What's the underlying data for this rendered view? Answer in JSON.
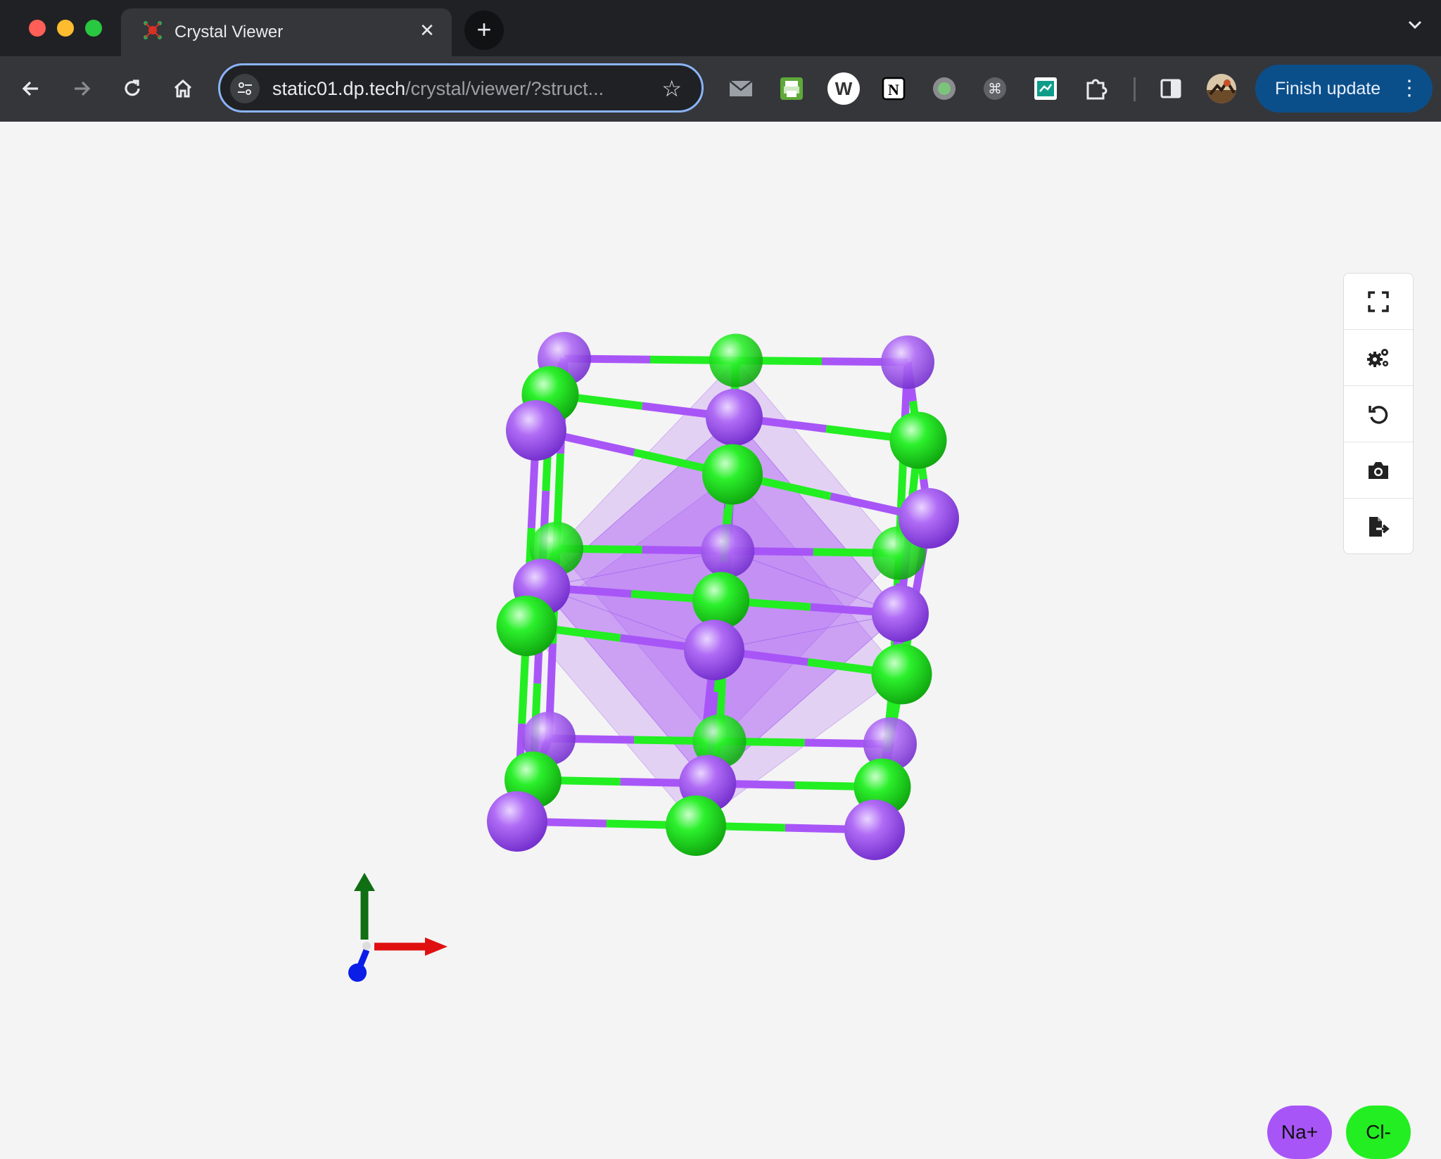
{
  "browser": {
    "tab": {
      "title": "Crystal Viewer"
    },
    "new_tab_label": "+",
    "address": {
      "host": "static01.dp.tech",
      "path": "/crystal/viewer/?struct..."
    },
    "update_button": {
      "label": "Finish update"
    }
  },
  "viewer": {
    "toolbar_icons": [
      "fullscreen-icon",
      "settings-gears-icon",
      "reset-view-icon",
      "camera-icon",
      "export-file-icon"
    ],
    "legend": [
      {
        "label": "Na+",
        "color": "#a855f7"
      },
      {
        "label": "Cl-",
        "color": "#22ee22"
      }
    ],
    "axes": {
      "x_color": "#e01010",
      "y_color": "#0f6f12",
      "z_color": "#0a1ee8"
    }
  }
}
